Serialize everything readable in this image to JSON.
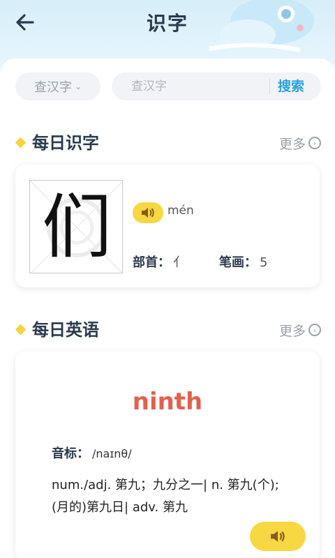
{
  "header": {
    "title": "识字",
    "back_icon": "arrow-left-icon"
  },
  "search": {
    "type_selected": "查汉字",
    "placeholder": "查汉字",
    "button": "搜索"
  },
  "daily_char": {
    "section_title": "每日识字",
    "more": "更多",
    "character": "们",
    "pinyin": "mén",
    "radical_label": "部首：",
    "radical": "亻",
    "strokes_label": "笔画：",
    "strokes": "5"
  },
  "daily_english": {
    "section_title": "每日英语",
    "more": "更多",
    "word": "ninth",
    "phonetic_label": "音标：",
    "phonetic": "/naɪnθ/",
    "definition_line1": "num./adj. 第九；九分之一| n. 第九(个);",
    "definition_line2": "(月的)第九日| adv. 第九"
  },
  "colors": {
    "accent_blue": "#2aa2e0",
    "accent_yellow": "#f7d842",
    "word_red": "#e0624d",
    "title_dark": "#2b3a4c"
  }
}
